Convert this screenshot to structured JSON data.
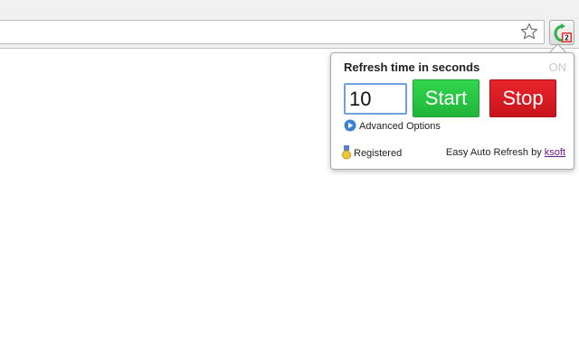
{
  "popup": {
    "title": "Refresh time in seconds",
    "status": "ON",
    "seconds_value": "10",
    "start_label": "Start",
    "stop_label": "Stop",
    "advanced_label": "Advanced Options",
    "registered_label": "Registered",
    "credit_text": "Easy Auto Refresh by",
    "credit_link": "ksoft"
  },
  "extension_badge": "2",
  "icons": {
    "bookmark": "star-icon",
    "extension": "refresh-icon",
    "advanced": "play-circle-icon",
    "registered": "medal-icon"
  },
  "colors": {
    "start": "#27c443",
    "stop": "#dc1a20",
    "link": "#6b1b86",
    "status": "#c8c8c8"
  }
}
